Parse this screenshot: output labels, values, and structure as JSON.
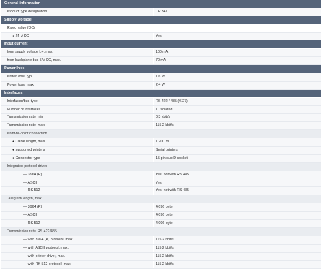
{
  "rows": [
    {
      "kind": "section",
      "label": "General information",
      "value": ""
    },
    {
      "kind": "data",
      "indent": 0,
      "label": "Product type designation",
      "value": "CP 341"
    },
    {
      "kind": "section",
      "label": "Supply voltage",
      "value": ""
    },
    {
      "kind": "plain",
      "indent": 0,
      "label": "Rated value (DC)",
      "value": ""
    },
    {
      "kind": "data",
      "indent": 1,
      "label": "● 24 V DC",
      "value": "Yes"
    },
    {
      "kind": "section",
      "label": "Input current",
      "value": ""
    },
    {
      "kind": "data",
      "indent": 0,
      "label": "from supply voltage L+, max.",
      "value": "100 mA"
    },
    {
      "kind": "data",
      "indent": 0,
      "label": "from backplane bus 5 V DC, max.",
      "value": "70 mA"
    },
    {
      "kind": "section",
      "label": "Power loss",
      "value": ""
    },
    {
      "kind": "data",
      "indent": 0,
      "label": "Power loss, typ.",
      "value": "1.6 W"
    },
    {
      "kind": "data",
      "indent": 0,
      "label": "Power loss, max.",
      "value": "2.4 W"
    },
    {
      "kind": "section",
      "label": "Interfaces",
      "value": ""
    },
    {
      "kind": "data",
      "indent": 0,
      "label": "Interfaces/bus type",
      "value": "RS 422 / 485 (X.27)"
    },
    {
      "kind": "data",
      "indent": 0,
      "label": "Number of interfaces",
      "value": "1; Isolated"
    },
    {
      "kind": "data",
      "indent": 0,
      "label": "Transmission rate, min",
      "value": "0.3 kbit/s"
    },
    {
      "kind": "data",
      "indent": 0,
      "label": "Transmission rate, max.",
      "value": "115.2 kbit/s"
    },
    {
      "kind": "sub",
      "label": "Point-to-point connection",
      "value": ""
    },
    {
      "kind": "data",
      "indent": 1,
      "label": "● Cable length, max.",
      "value": "1 200 m"
    },
    {
      "kind": "data",
      "indent": 1,
      "label": "● supported printers",
      "value": "Serial printers"
    },
    {
      "kind": "data",
      "indent": 1,
      "label": "● Connector type",
      "value": "15-pin sub D socket"
    },
    {
      "kind": "sub",
      "label": "Integrated protocol driver",
      "value": ""
    },
    {
      "kind": "data",
      "indent": 2,
      "label": "— 3964 (R)",
      "value": "Yes; not with RS 485"
    },
    {
      "kind": "data",
      "indent": 2,
      "label": "— ASCII",
      "value": "Yes"
    },
    {
      "kind": "data",
      "indent": 2,
      "label": "— RK 512",
      "value": "Yes; not with RS 485"
    },
    {
      "kind": "sub",
      "label": "Telegram length, max.",
      "value": ""
    },
    {
      "kind": "data",
      "indent": 2,
      "label": "— 3964 (R)",
      "value": "4 096 byte"
    },
    {
      "kind": "data",
      "indent": 2,
      "label": "— ASCII",
      "value": "4 096 byte"
    },
    {
      "kind": "data",
      "indent": 2,
      "label": "— RK 512",
      "value": "4 096 byte"
    },
    {
      "kind": "sub",
      "label": "Transmission rate, RS 422/485",
      "value": ""
    },
    {
      "kind": "data",
      "indent": 2,
      "label": "— with 3964 (R) protocol, max.",
      "value": "115.2 kbit/s"
    },
    {
      "kind": "data",
      "indent": 2,
      "label": "— with ASCII protocol, max.",
      "value": "115.2 kbit/s"
    },
    {
      "kind": "data",
      "indent": 2,
      "label": "— with printer driver, max.",
      "value": "115.2 kbit/s"
    },
    {
      "kind": "data",
      "indent": 2,
      "label": "— with RK 512 protocol, max.",
      "value": "115.2 kbit/s"
    }
  ]
}
